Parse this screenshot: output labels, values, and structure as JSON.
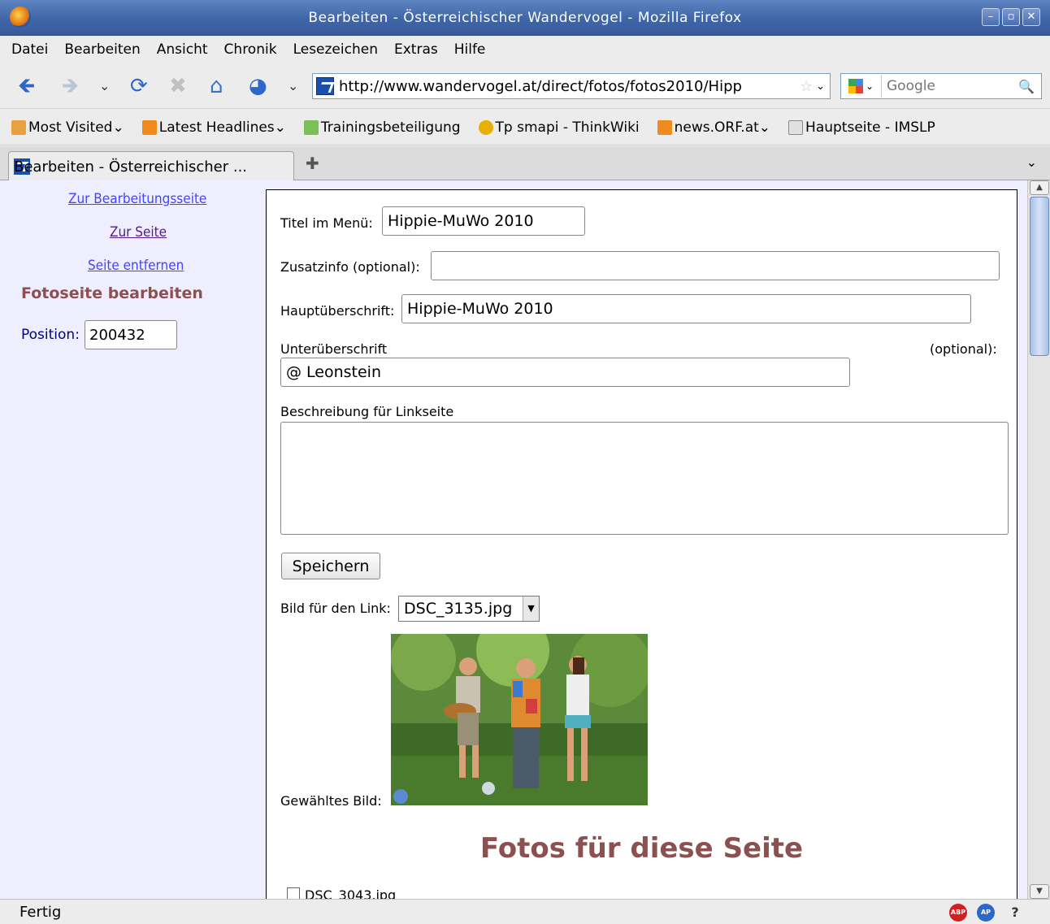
{
  "window": {
    "title": "Bearbeiten - Österreichischer Wandervogel - Mozilla Firefox"
  },
  "menu": [
    "Datei",
    "Bearbeiten",
    "Ansicht",
    "Chronik",
    "Lesezeichen",
    "Extras",
    "Hilfe"
  ],
  "nav": {
    "url": "http://www.wandervogel.at/direct/fotos/fotos2010/Hipp",
    "search_placeholder": "Google"
  },
  "bookmarks": [
    "Most Visited",
    "Latest Headlines",
    "Trainingsbeteiligung",
    "Tp smapi - ThinkWiki",
    "news.ORF.at",
    "Hauptseite - IMSLP"
  ],
  "tab": {
    "label": "Bearbeiten - Österreichischer ..."
  },
  "sidebar": {
    "links": [
      "Zur Bearbeitungsseite",
      "Zur Seite",
      "Seite entfernen"
    ],
    "heading": "Fotoseite bearbeiten",
    "position_label": "Position:",
    "position_value": "200432"
  },
  "form": {
    "title_label": "Titel im Menü:",
    "title_value": "Hippie-MuWo 2010",
    "extra_label": "Zusatzinfo (optional):",
    "extra_value": "",
    "heading_label": "Hauptüberschrift:",
    "heading_value": "Hippie-MuWo 2010",
    "subheading_label": "Unterüberschrift",
    "subheading_optional": "(optional):",
    "subheading_value": "@ Leonstein",
    "desc_label": "Beschreibung für Linkseite",
    "save_label": "Speichern",
    "image_select_label": "Bild für den Link:",
    "image_select_value": "DSC_3135.jpg",
    "chosen_image_label": "Gewähltes Bild:",
    "photos_heading": "Fotos für diese Seite",
    "first_photo": "DSC_3043.jpg"
  },
  "status": {
    "text": "Fertig"
  }
}
